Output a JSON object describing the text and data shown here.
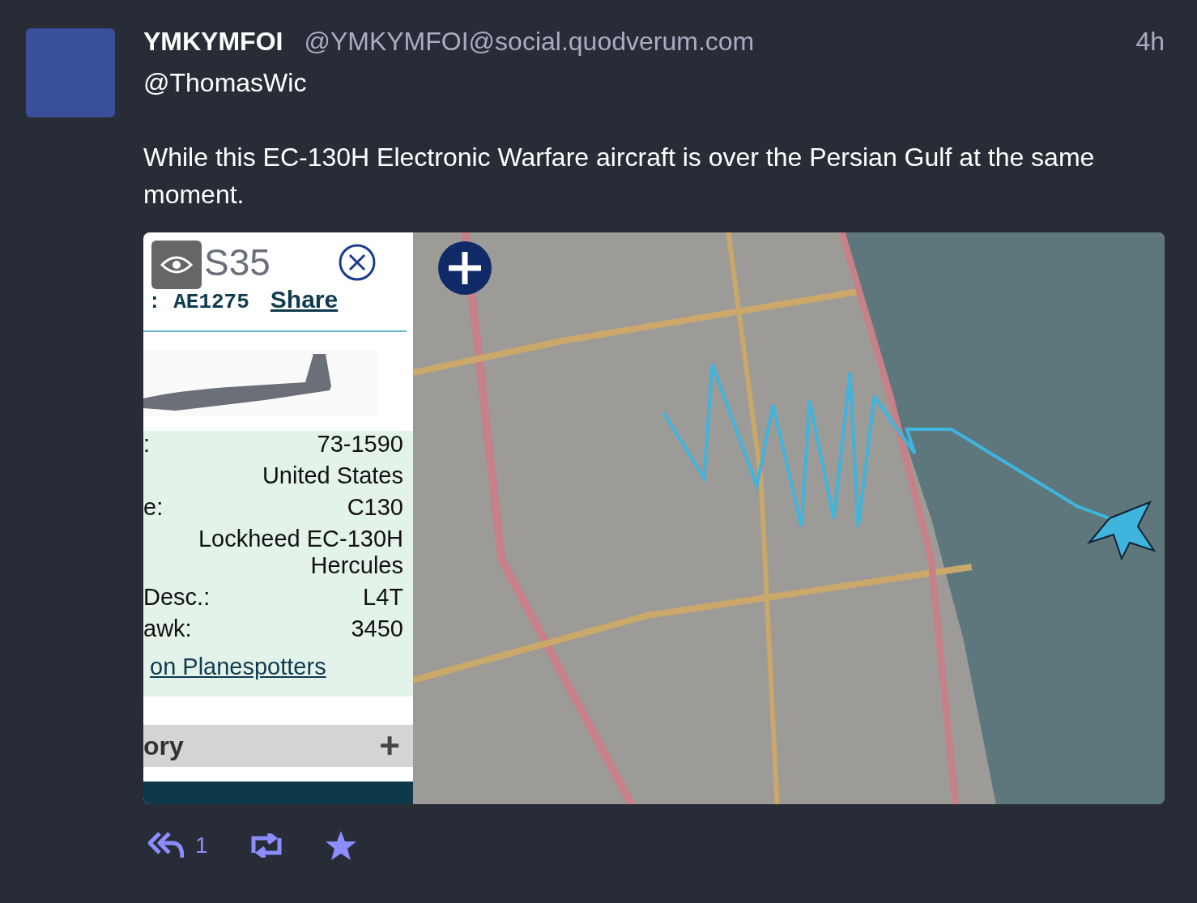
{
  "post": {
    "display_name": "YMKYMFOI",
    "handle": "@YMKYMFOI@social.quodverum.com",
    "time": "4h",
    "mention": "@ThomasWic",
    "text": "While this EC-130H Electronic Warfare aircraft is over the Persian Gulf at the same moment."
  },
  "media": {
    "panel": {
      "callsign": "S35",
      "hex": ": AE1275",
      "share": "Share",
      "rows": [
        {
          "label": ":",
          "value": "73-1590"
        },
        {
          "value": "United States"
        },
        {
          "label": "e:",
          "value": "C130"
        },
        {
          "value": "Lockheed EC-130H Hercules"
        },
        {
          "label": "Desc.:",
          "value": "L4T"
        },
        {
          "label": "awk:",
          "value": "3450"
        }
      ],
      "link": "on Planespotters",
      "section": "ory",
      "section_button": "+"
    }
  },
  "actions": {
    "reply_count": "1"
  }
}
